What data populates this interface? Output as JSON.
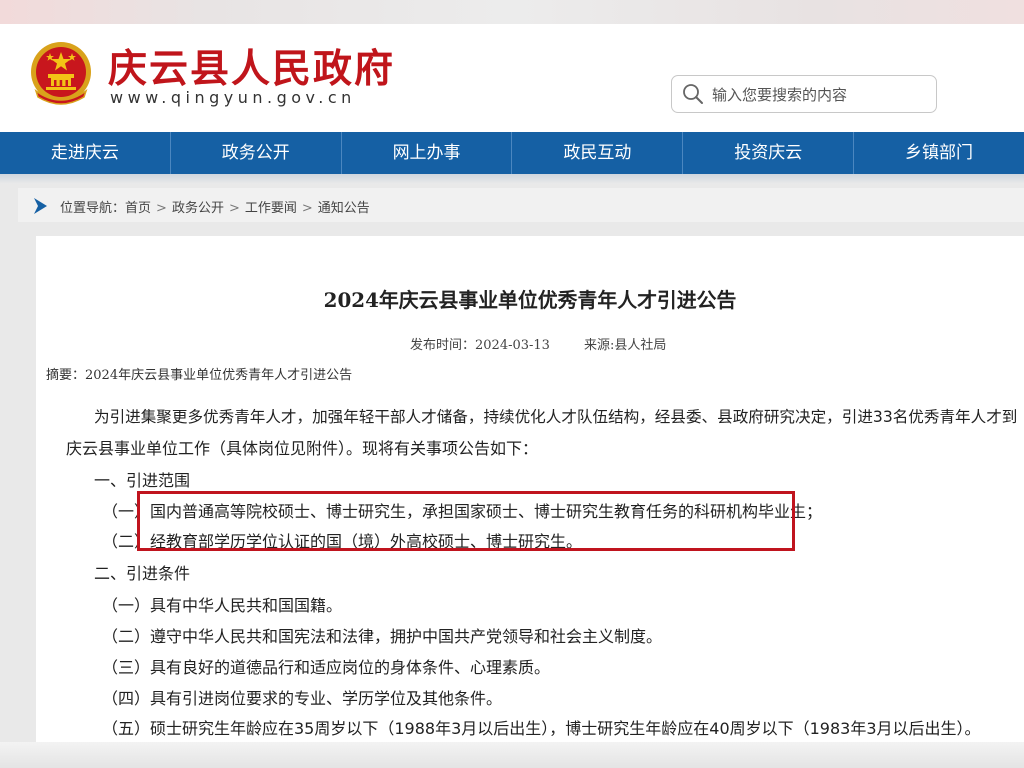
{
  "header": {
    "site_title": "庆云县人民政府",
    "site_url": "www.qingyun.gov.cn",
    "search_placeholder": "输入您要搜索的内容"
  },
  "nav": {
    "items": [
      "走进庆云",
      "政务公开",
      "网上办事",
      "政民互动",
      "投资庆云",
      "乡镇部门"
    ]
  },
  "breadcrumb": {
    "prefix": "位置导航：",
    "items": [
      "首页",
      "政务公开",
      "工作要闻",
      "通知公告"
    ]
  },
  "article": {
    "title": "2024年庆云县事业单位优秀青年人才引进公告",
    "publish_label": "发布时间：2024-03-13",
    "source_label": "来源:县人社局",
    "summary": "摘要：2024年庆云县事业单位优秀青年人才引进公告",
    "intro_1": "为引进集聚更多优秀青年人才，加强年轻干部人才储备，持续优化人才队伍结构，经县委、县政府研究决定，引进33名优秀青年人才到",
    "intro_2": "庆云县事业单位工作（具体岗位见附件）。现将有关事项公告如下：",
    "section1_heading": "一、引进范围",
    "section1_items": [
      {
        "num": "（一）",
        "text": "国内普通高等院校硕士、博士研究生，承担国家硕士、博士研究生教育任务的科研机构毕业生；"
      },
      {
        "num": "（二）",
        "text": "经教育部学历学位认证的国（境）外高校硕士、博士研究生。"
      }
    ],
    "section2_heading": "二、引进条件",
    "section2_items": [
      "（一）具有中华人民共和国国籍。",
      "（二）遵守中华人民共和国宪法和法律，拥护中国共产党领导和社会主义制度。",
      "（三）具有良好的道德品行和适应岗位的身体条件、心理素质。",
      "（四）具有引进岗位要求的专业、学历学位及其他条件。",
      "（五）硕士研究生年龄应在35周岁以下（1988年3月以后出生），博士研究生年龄应在40周岁以下（1983年3月以后出生）。"
    ]
  },
  "colors": {
    "brand_red": "#c0151b",
    "nav_blue": "#1560a4",
    "highlight_red": "#c0141e"
  }
}
